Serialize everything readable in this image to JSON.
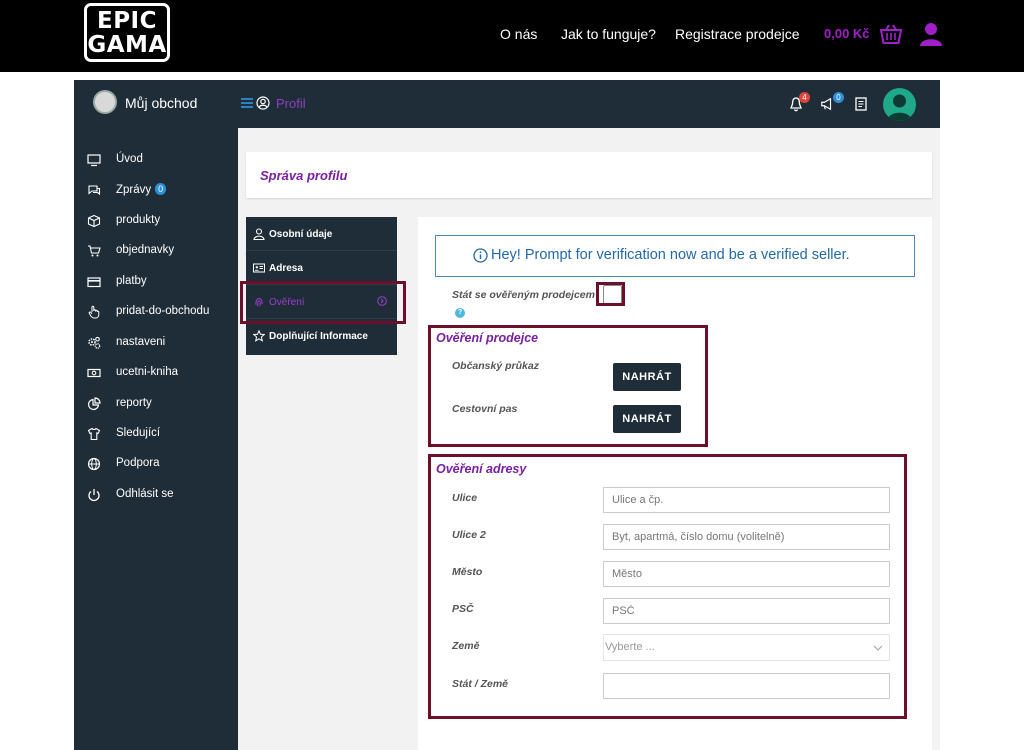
{
  "topbar": {
    "logo_line1": "EPIC",
    "logo_line2": "GAMA",
    "nav": [
      "O nás",
      "Jak to funguje?",
      "Registrace prodejce"
    ],
    "cart_total": "0,00 Kč",
    "cart_icon": "basket-icon",
    "user_icon": "user-icon"
  },
  "header": {
    "shop_name": "Můj obchod",
    "breadcrumb": "Profil",
    "notifications_count": "4",
    "announcements_count": "0"
  },
  "sidebar": {
    "items": [
      {
        "label": "Úvod",
        "icon": "monitor-icon"
      },
      {
        "label": "Zprávy",
        "icon": "chat-icon",
        "badge": "0"
      },
      {
        "label": "produkty",
        "icon": "box-icon"
      },
      {
        "label": "objednavky",
        "icon": "cart-icon"
      },
      {
        "label": "platby",
        "icon": "credit-card-icon"
      },
      {
        "label": "pridat-do-obchodu",
        "icon": "hand-pointer-icon"
      },
      {
        "label": "nastaveni",
        "icon": "gears-icon"
      },
      {
        "label": "ucetni-kniha",
        "icon": "money-icon"
      },
      {
        "label": "reporty",
        "icon": "pie-chart-icon"
      },
      {
        "label": "Sledující",
        "icon": "shirt-icon"
      },
      {
        "label": "Podpora",
        "icon": "globe-icon"
      },
      {
        "label": "Odhlásit se",
        "icon": "power-icon"
      }
    ]
  },
  "main": {
    "page_title": "Správa profilu",
    "tabs": [
      {
        "label": "Osobní údaje",
        "icon": "user-outline-icon"
      },
      {
        "label": "Adresa",
        "icon": "id-card-icon"
      },
      {
        "label": "Ověření",
        "icon": "fingerprint-icon",
        "active": true
      },
      {
        "label": "Doplňující Informace",
        "icon": "star-icon"
      }
    ],
    "alert_text": "Hey! Prompt for verification now and be a verified seller.",
    "become_verified_label": "Stát se ověřeným prodejcem",
    "seller_section": {
      "title": "Ověření prodejce",
      "id_card_label": "Občanský průkaz",
      "passport_label": "Cestovní pas",
      "upload_label": "NAHRÁT"
    },
    "address_section": {
      "title": "Ověření adresy",
      "street_label": "Ulice",
      "street_placeholder": "Ulice a čp.",
      "street2_label": "Ulice 2",
      "street2_placeholder": "Byt, apartmá, číslo domu (volitelně)",
      "city_label": "Město",
      "city_placeholder": "Město",
      "zip_label": "PSČ",
      "zip_placeholder": "PSČ",
      "country_label": "Země",
      "country_placeholder": "Vyberte ...",
      "state_label": "Stát / Země",
      "state_value": ""
    }
  },
  "colors": {
    "dark": "#1f2d38",
    "accent": "#7a1fa2",
    "highlight": "#6b0f2a",
    "info": "#2469a8"
  }
}
